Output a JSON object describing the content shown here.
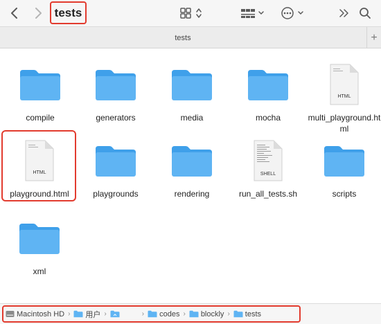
{
  "toolbar": {
    "title": "tests",
    "icons": [
      "chevron-left-icon",
      "chevron-right-icon",
      "grid-view-icon",
      "group-icon",
      "action-icon",
      "more-icon",
      "search-icon"
    ]
  },
  "tab": {
    "label": "tests",
    "add_label": "+"
  },
  "files": [
    {
      "name": "compile",
      "type": "folder"
    },
    {
      "name": "generators",
      "type": "folder"
    },
    {
      "name": "media",
      "type": "folder"
    },
    {
      "name": "mocha",
      "type": "folder"
    },
    {
      "name": "multi_playground.html",
      "type": "html",
      "badge": "HTML"
    },
    {
      "name": "playground.html",
      "type": "html",
      "badge": "HTML",
      "selected_box": true
    },
    {
      "name": "playgrounds",
      "type": "folder"
    },
    {
      "name": "rendering",
      "type": "folder"
    },
    {
      "name": "run_all_tests.sh",
      "type": "shell",
      "badge": "SHELL"
    },
    {
      "name": "scripts",
      "type": "folder"
    },
    {
      "name": "xml",
      "type": "folder"
    }
  ],
  "path": [
    {
      "label": "Macintosh HD",
      "icon": "disk-icon"
    },
    {
      "label": "用户",
      "icon": "folder-icon"
    },
    {
      "label": "",
      "icon": "home-folder-icon"
    },
    {
      "label": "codes",
      "icon": "folder-icon"
    },
    {
      "label": "blockly",
      "icon": "folder-icon"
    },
    {
      "label": "tests",
      "icon": "folder-icon"
    }
  ],
  "colors": {
    "folder": "#5fb4f3",
    "folder_dark": "#3fa0ea",
    "highlight": "#e23b2e"
  }
}
